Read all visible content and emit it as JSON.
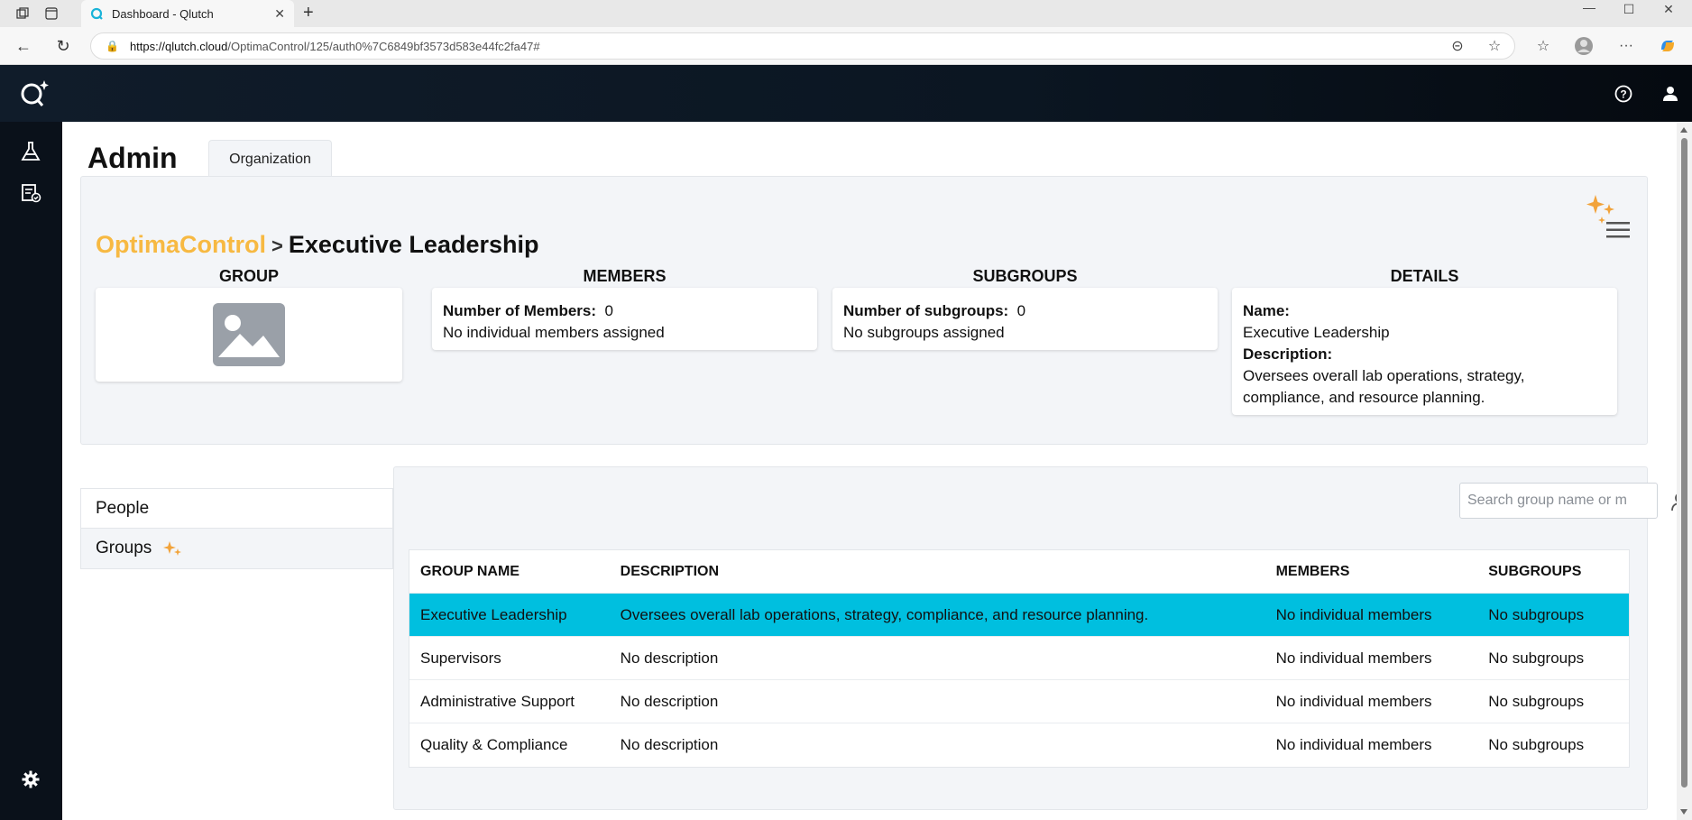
{
  "browser": {
    "tab_title": "Dashboard - Qlutch",
    "url_host": "https://qlutch.cloud",
    "url_path": "/OptimaControl/125/auth0%7C6849bf3573d583e44fc2fa47#"
  },
  "page": {
    "title": "Admin",
    "tab_label": "Organization"
  },
  "breadcrumb": {
    "parent": "OptimaControl",
    "separator": ">",
    "current": "Executive Leadership"
  },
  "summary": {
    "group_heading": "GROUP",
    "members_heading": "MEMBERS",
    "subgroups_heading": "SUBGROUPS",
    "details_heading": "DETAILS",
    "members_count_label": "Number of Members:",
    "members_count": "0",
    "members_note": "No individual members assigned",
    "subgroups_count_label": "Number of subgroups:",
    "subgroups_count": "0",
    "subgroups_note": "No subgroups assigned",
    "name_label": "Name:",
    "name_value": "Executive Leadership",
    "description_label": "Description:",
    "description_line1": "Oversees overall lab operations, strategy,",
    "description_line2": "compliance, and resource planning."
  },
  "side_nav": {
    "people": "People",
    "groups": "Groups"
  },
  "search": {
    "placeholder": "Search group name or m"
  },
  "table": {
    "headers": [
      "GROUP NAME",
      "DESCRIPTION",
      "MEMBERS",
      "SUBGROUPS"
    ],
    "rows": [
      {
        "name": "Executive Leadership",
        "description": "Oversees overall lab operations, strategy, compliance, and resource planning.",
        "members": "No individual members",
        "subgroups": "No subgroups"
      },
      {
        "name": "Supervisors",
        "description": "No description",
        "members": "No individual members",
        "subgroups": "No subgroups"
      },
      {
        "name": "Administrative Support",
        "description": "No description",
        "members": "No individual members",
        "subgroups": "No subgroups"
      },
      {
        "name": "Quality & Compliance",
        "description": "No description",
        "members": "No individual members",
        "subgroups": "No subgroups"
      }
    ]
  },
  "colors": {
    "accent_gold": "#f7b942",
    "selected_row": "#00bfdf",
    "header_dark": "#0b1622"
  }
}
